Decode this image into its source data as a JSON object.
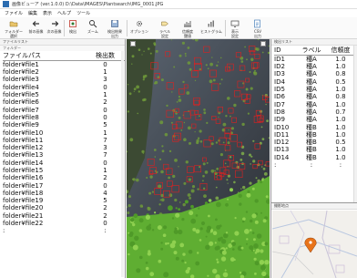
{
  "window": {
    "title": "画像ビューア (ver.1.0.0) D:\\Data\\IMAGES\\Plantsearch\\IMG_0001.JPG"
  },
  "menu": [
    "ファイル",
    "編集",
    "表示",
    "ヘルプ",
    "ツール"
  ],
  "toolbar": [
    {
      "label": "フォルダー\n選択",
      "icon": "folder-open-icon"
    },
    {
      "label": "前の画像",
      "icon": "arrow-left-icon"
    },
    {
      "label": "次の画像",
      "icon": "arrow-right-icon"
    },
    {
      "label": "検出",
      "icon": "detect-icon"
    },
    {
      "label": "ズーム",
      "icon": "zoom-icon"
    },
    {
      "label": "検出結果\n出力",
      "icon": "save-icon"
    },
    {
      "label": "オプション",
      "icon": "options-icon"
    },
    {
      "label": "ラベル\n設定",
      "icon": "label-icon"
    },
    {
      "label": "信頼度\n閾値",
      "icon": "threshold-icon"
    },
    {
      "label": "ヒストグラム",
      "icon": "histogram-icon"
    },
    {
      "label": "表示\n設定",
      "icon": "display-icon"
    },
    {
      "label": "CSV\n出力",
      "icon": "csv-icon"
    }
  ],
  "left_panel": {
    "title": "ファイルリスト",
    "subtitle": "フォルダー",
    "col_path": "ファイルパス",
    "col_count": "検出数",
    "rows": [
      {
        "path": "folder¥file1",
        "count": "0"
      },
      {
        "path": "folder¥file2",
        "count": "1"
      },
      {
        "path": "folder¥file3",
        "count": "3"
      },
      {
        "path": "folder¥file4",
        "count": "0"
      },
      {
        "path": "folder¥file5",
        "count": "1"
      },
      {
        "path": "folder¥file6",
        "count": "2"
      },
      {
        "path": "folder¥file7",
        "count": "0"
      },
      {
        "path": "folder¥file8",
        "count": "0"
      },
      {
        "path": "folder¥file9",
        "count": "5"
      },
      {
        "path": "folder¥file10",
        "count": "1"
      },
      {
        "path": "folder¥file11",
        "count": "7"
      },
      {
        "path": "folder¥file12",
        "count": "3"
      },
      {
        "path": "folder¥file13",
        "count": "7"
      },
      {
        "path": "folder¥file14",
        "count": "0"
      },
      {
        "path": "folder¥file15",
        "count": "1"
      },
      {
        "path": "folder¥file16",
        "count": "2"
      },
      {
        "path": "folder¥file17",
        "count": "0"
      },
      {
        "path": "folder¥file18",
        "count": "4"
      },
      {
        "path": "folder¥file19",
        "count": "5"
      },
      {
        "path": "folder¥file20",
        "count": "2"
      },
      {
        "path": "folder¥file21",
        "count": "2"
      },
      {
        "path": "folder¥file22",
        "count": "0"
      },
      {
        "path": ":",
        "count": ":"
      }
    ]
  },
  "right_panel": {
    "title": "検出リスト",
    "col_id": "ID",
    "col_label": "ラベル",
    "col_conf": "信頼度",
    "rows": [
      {
        "id": "ID1",
        "label": "種A",
        "conf": "1.0"
      },
      {
        "id": "ID2",
        "label": "種A",
        "conf": "1.0"
      },
      {
        "id": "ID3",
        "label": "種A",
        "conf": "0.8"
      },
      {
        "id": "ID4",
        "label": "種A",
        "conf": "0.5"
      },
      {
        "id": "ID5",
        "label": "種A",
        "conf": "1.0"
      },
      {
        "id": "ID6",
        "label": "種A",
        "conf": "0.8"
      },
      {
        "id": "ID7",
        "label": "種A",
        "conf": "1.0"
      },
      {
        "id": "ID8",
        "label": "種A",
        "conf": "0.7"
      },
      {
        "id": "ID9",
        "label": "種A",
        "conf": "1.0"
      },
      {
        "id": "ID10",
        "label": "種B",
        "conf": "1.0"
      },
      {
        "id": "ID11",
        "label": "種B",
        "conf": "1.0"
      },
      {
        "id": "ID12",
        "label": "種B",
        "conf": "0.5"
      },
      {
        "id": "ID13",
        "label": "種B",
        "conf": "1.0"
      },
      {
        "id": "ID14",
        "label": "種B",
        "conf": "1.0"
      },
      {
        "id": ":",
        "label": ":",
        "conf": ":"
      }
    ]
  },
  "map_panel": {
    "title": "撮影地点"
  },
  "colors": {
    "detection_box": "#e02020",
    "map_marker": "#e8731a",
    "grass": "#6fbf3c"
  }
}
